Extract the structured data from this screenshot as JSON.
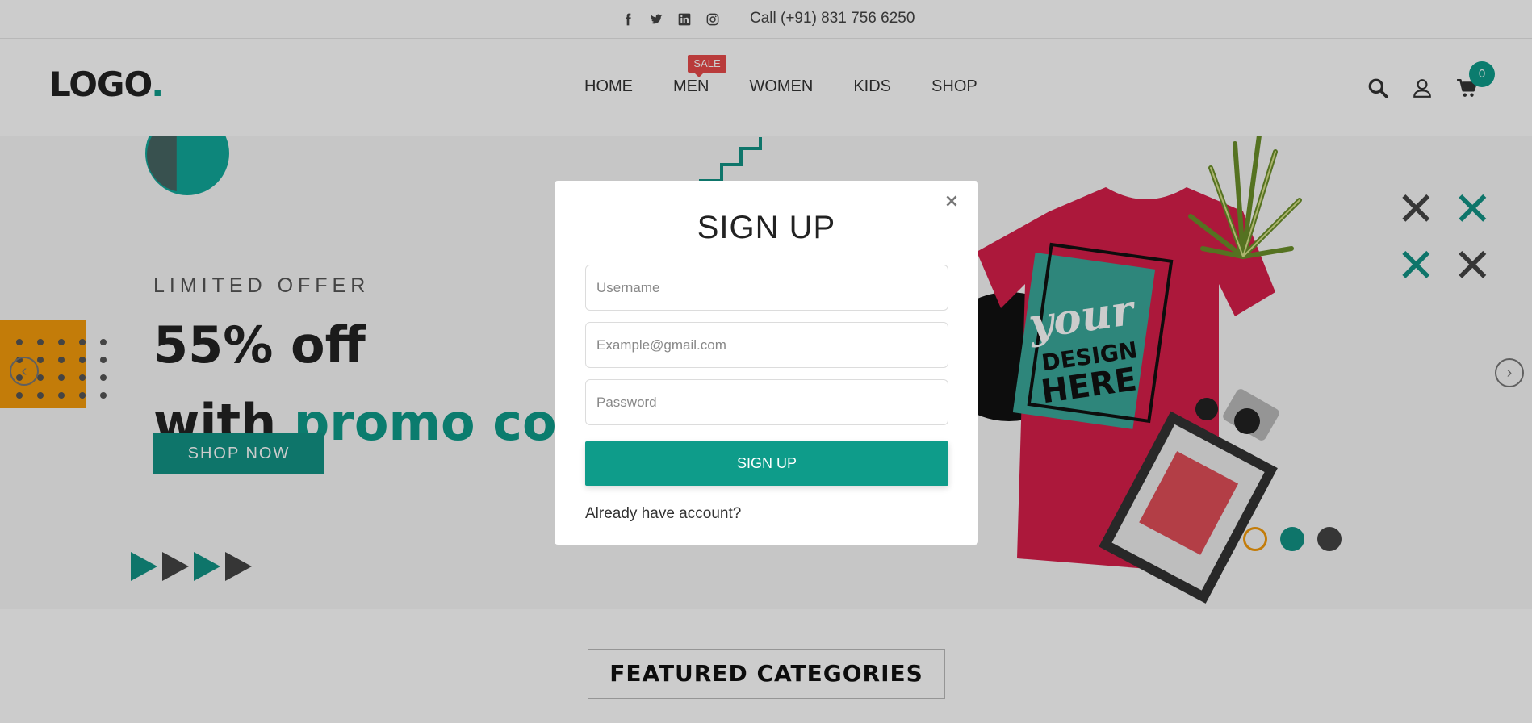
{
  "topbar": {
    "social_icons": [
      "facebook-icon",
      "twitter-icon",
      "linkedin-icon",
      "instagram-icon"
    ],
    "phone": "Call (+91) 831 756 6250"
  },
  "header": {
    "logo": "LOGO",
    "logo_dot": ".",
    "nav": [
      "HOME",
      "MEN",
      "WOMEN",
      "KIDS",
      "SHOP"
    ],
    "sale_badge": "SALE",
    "cart_count": "0",
    "icons": [
      "search-icon",
      "user-icon",
      "cart-icon"
    ]
  },
  "hero": {
    "eyebrow": "LIMITED OFFER",
    "headline_line1": "55% off",
    "headline_with": "with ",
    "headline_highlight": "promo code",
    "button": "SHOP NOW",
    "art_text_your": "your",
    "art_text_design": "DESIGN",
    "art_text_here": "HERE",
    "slide_count": 3,
    "active_slide": 2
  },
  "modal": {
    "title": "SIGN UP",
    "close_label": "×",
    "username_placeholder": "Username",
    "email_placeholder": "Example@gmail.com",
    "password_placeholder": "Password",
    "submit": "SIGN UP",
    "footer_link": "Already have account?"
  },
  "featured": {
    "heading": "FEATURED CATEGORIES"
  },
  "colors": {
    "accent": "#0e9c8a",
    "sale": "#e84a4a",
    "orange": "#f49b0c",
    "shirt": "#d81e4a"
  }
}
